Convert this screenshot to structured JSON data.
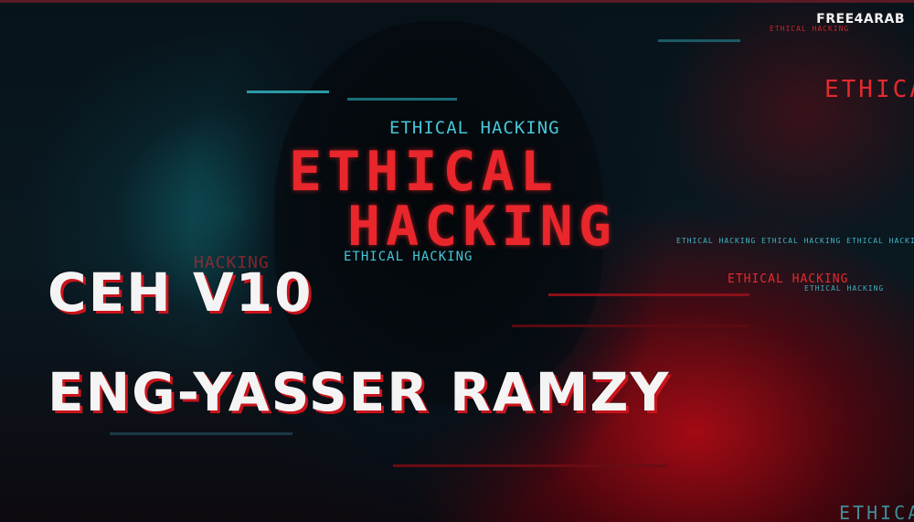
{
  "brand": "FREE4ARAB",
  "overlay": {
    "center_top": "ETHICAL HACKING",
    "big_line1": "ETHICAL",
    "big_line2": "HACKING",
    "center_small": "ETHICAL HACKING",
    "right_top": "ETHICAL",
    "right_top_small": "ETHICAL HACKING",
    "right_mid": "ETHICAL HACKING",
    "right_mid_small": "ETHICAL HACKING",
    "right_row": "ETHICAL HACKING   ETHICAL HACKING   ETHICAL HACKING   ETHICAL",
    "left_glitch": "HACKING",
    "bottom_right": "ETHICAL"
  },
  "headline": {
    "line1": "CEH V10",
    "line2": "ENG-YASSER RAMZY"
  },
  "colors": {
    "cyan": "#47c6d6",
    "red": "#e22a2e",
    "headline": "#f4f4f4",
    "headline_shadow": "#c9141c"
  }
}
